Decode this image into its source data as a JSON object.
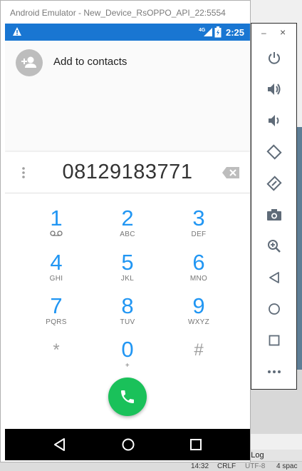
{
  "emulator": {
    "title": "Android Emulator - New_Device_RsOPPO_API_22:5554"
  },
  "statusbar": {
    "network": "4G",
    "time": "2:25"
  },
  "add_contact": {
    "label": "Add to contacts"
  },
  "dialer": {
    "number": "08129183771",
    "keys": [
      {
        "digit": "1",
        "letters": ""
      },
      {
        "digit": "2",
        "letters": "ABC"
      },
      {
        "digit": "3",
        "letters": "DEF"
      },
      {
        "digit": "4",
        "letters": "GHI"
      },
      {
        "digit": "5",
        "letters": "JKL"
      },
      {
        "digit": "6",
        "letters": "MNO"
      },
      {
        "digit": "7",
        "letters": "PQRS"
      },
      {
        "digit": "8",
        "letters": "TUV"
      },
      {
        "digit": "9",
        "letters": "WXYZ"
      },
      {
        "digit": "*",
        "letters": ""
      },
      {
        "digit": "0",
        "letters": "+"
      },
      {
        "digit": "#",
        "letters": ""
      }
    ]
  },
  "toolbar": {
    "minimize": "–",
    "close": "×"
  },
  "ide": {
    "log_tab": "nt Log",
    "status_time": "14:32",
    "status_crlf": "CRLF",
    "status_utf": "UTF-8",
    "status_spaces": "4 spac"
  },
  "colors": {
    "statusbar": "#1976d2",
    "digit": "#2196f3",
    "call": "#1ac15a"
  }
}
